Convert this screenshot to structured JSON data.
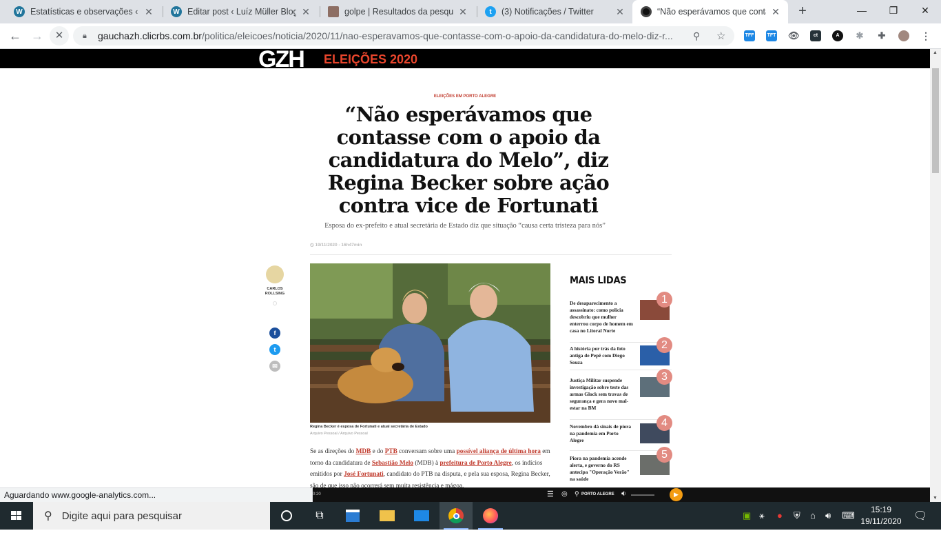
{
  "browser": {
    "tabs": [
      {
        "title": "Estatísticas e observações ‹ Luí",
        "icon": "wordpress-icon",
        "active": false
      },
      {
        "title": "Editar post ‹ Luíz Müller Blog —",
        "icon": "wordpress-icon",
        "active": false
      },
      {
        "title": "golpe | Resultados da pesquisa",
        "icon": "avatar-icon",
        "active": false
      },
      {
        "title": "(3) Notificações / Twitter",
        "icon": "twitter-icon",
        "active": false
      },
      {
        "title": "“Não esperávamos que contas",
        "icon": "gzh-icon",
        "active": true
      }
    ],
    "url_host": "gauchazh.clicrbs.com.br",
    "url_path": "/politica/eleicoes/noticia/2020/11/nao-esperavamos-que-contasse-com-o-apoio-da-candidatura-do-melo-diz-r...",
    "extensions": [
      {
        "label": "TFF",
        "color": "#1e88e5"
      },
      {
        "label": "TFT",
        "color": "#1e88e5"
      },
      {
        "label": "",
        "color": "#5f6368"
      },
      {
        "label": "ct",
        "color": "#263238"
      },
      {
        "label": "A",
        "color": "#111111"
      }
    ],
    "status_text": "Aguardando www.google-analytics.com..."
  },
  "site": {
    "logo": "GZH",
    "section": "ELEIÇÕES 2020",
    "brand_color": "#e8452c"
  },
  "article": {
    "kicker": "ELEIÇÕES EM PORTO ALEGRE",
    "headline": "“Não esperávamos que contasse com o apoio da candidatura do Melo”, diz Regina Becker sobre ação contra vice de Fortunati",
    "subhead": "Esposa do ex-prefeito e atual secretária de Estado diz que situação “causa certa tristeza para nós”",
    "date": "19/11/2020 - 16h47min",
    "author": "CARLOS ROLLSING",
    "photo_caption": "Regina Becker é esposa de Fortunati e atual secretária de Estado",
    "photo_credit": "Arquivo Pessoal / Arquivo Pessoal",
    "body": {
      "t1": "Se as direções do ",
      "l1": "MDB",
      "t2": " e do ",
      "l2": "PTB",
      "t3": " conversam sobre uma ",
      "l3": "possível aliança de última hora",
      "t4": " em torno da candidatura de ",
      "l4": "Sebastião Melo",
      "t5": " (MDB) à ",
      "l5": "prefeitura de Porto Alegre",
      "t6": ", os indícios emitidos por ",
      "l6": "José Fortunati",
      "t7": ", candidato do PTB na disputa, e pela sua esposa, Regina Becker, são de que isso não ocorrerá sem muita resistência e mágoa."
    }
  },
  "most_read": {
    "title": "MAIS LIDAS",
    "items": [
      {
        "rank": "1",
        "text": "De desaparecimento a assassinato: como polícia descobriu que mulher enterrou corpo de homem em casa no Litoral Norte"
      },
      {
        "rank": "2",
        "text": "A história por trás da foto antiga de Pepê com Diego Souza"
      },
      {
        "rank": "3",
        "text": "Justiça Militar suspende investigação sobre teste das armas Glock sem travas de segurança e gera novo mal-estar na BM"
      },
      {
        "rank": "4",
        "text": "Novembro dá sinais de piora na pandemia em Porto Alegre"
      },
      {
        "rank": "5",
        "text": "Piora na pandemia acende alerta, e governo do RS antecipa \"Operação Verão\" na saúde"
      }
    ]
  },
  "player": {
    "location": "PORTO ALEGRE",
    "time": "0:20"
  },
  "taskbar": {
    "search_placeholder": "Digite aqui para pesquisar",
    "time": "15:19",
    "date": "19/11/2020"
  }
}
